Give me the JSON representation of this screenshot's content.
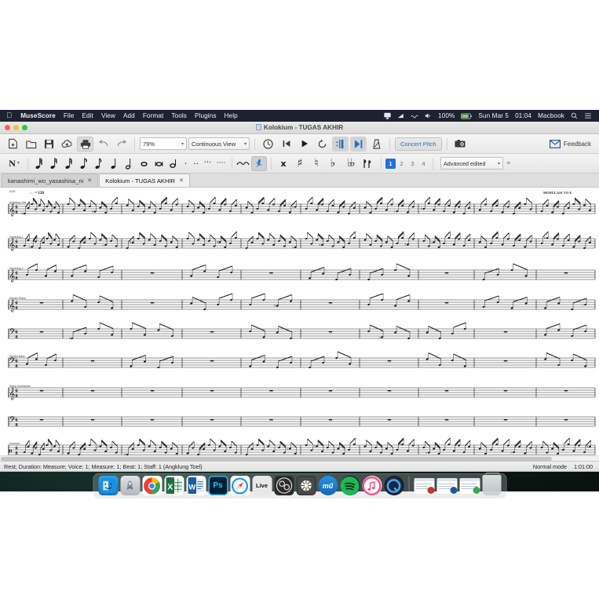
{
  "menubar": {
    "apple": "apple-logo",
    "app_name": "MuseScore",
    "items": [
      "File",
      "Edit",
      "View",
      "Add",
      "Format",
      "Tools",
      "Plugins",
      "Help"
    ],
    "status_items": [
      {
        "name": "airplay-icon",
        "label": "⌹"
      },
      {
        "name": "wifi-icon",
        "label": "◢"
      },
      {
        "name": "bluetooth-icon",
        "label": "∿"
      },
      {
        "name": "volume-icon",
        "label": "🔊"
      }
    ],
    "battery_percent": "100%",
    "date": "Sun Mar 5",
    "time": "01:04",
    "user": "Macbook",
    "search_icon": "search-icon",
    "control_center_icon": "control-center-icon"
  },
  "window": {
    "title": "Kolokium - TUGAS AKHIR"
  },
  "toolbar": {
    "buttons": [
      {
        "name": "new-score-button",
        "glyph": "➕",
        "pressed": false
      },
      {
        "name": "open-score-button",
        "glyph": "🗁",
        "pressed": false
      },
      {
        "name": "save-score-button",
        "glyph": "💾",
        "pressed": false
      },
      {
        "name": "save-online-button",
        "glyph": "☁",
        "pressed": false
      },
      {
        "name": "print-button",
        "glyph": "🖨",
        "pressed": true
      },
      {
        "name": "undo-button",
        "glyph": "↶",
        "pressed": false
      },
      {
        "name": "redo-button",
        "glyph": "↷",
        "pressed": false
      }
    ],
    "zoom_value": "79%",
    "view_value": "Continuous View",
    "playback": [
      {
        "name": "metronome-button",
        "glyph": "⏱"
      },
      {
        "name": "rewind-button",
        "glyph": "◀▌"
      },
      {
        "name": "play-button",
        "glyph": "▶"
      },
      {
        "name": "loop-button",
        "glyph": "↻"
      },
      {
        "name": "play-repeats-button",
        "glyph": "∥"
      },
      {
        "name": "play-panel-button",
        "glyph": "▶▌"
      },
      {
        "name": "metronome-toggle-button",
        "glyph": "↗"
      }
    ],
    "concert_pitch_label": "Concert Pitch",
    "image_capture_name": "image-capture-button",
    "feedback_label": "Feedback"
  },
  "note_toolbar": {
    "note_input_label": "N",
    "durations": [
      {
        "name": "duration-64th",
        "glyph": "♫"
      },
      {
        "name": "duration-32nd",
        "glyph": "♫"
      },
      {
        "name": "duration-16th",
        "glyph": "♫"
      },
      {
        "name": "duration-eighth",
        "glyph": "♪"
      },
      {
        "name": "duration-eighth-2",
        "glyph": "♪"
      },
      {
        "name": "duration-quarter",
        "glyph": "♩"
      },
      {
        "name": "duration-half",
        "glyph": "ᴕe"
      },
      {
        "name": "duration-whole",
        "glyph": "ᴕd"
      },
      {
        "name": "duration-breve",
        "glyph": "ᴕc"
      },
      {
        "name": "duration-longa",
        "glyph": "ᴛ6"
      }
    ],
    "dots": [
      {
        "name": "dot-single",
        "glyph": "·"
      },
      {
        "name": "dot-double",
        "glyph": "··"
      },
      {
        "name": "dot-triple",
        "glyph": "···"
      },
      {
        "name": "dot-quadruple",
        "glyph": "····"
      }
    ],
    "tie_name": "tie-button",
    "rest_name": "rest-button",
    "accidentals": [
      {
        "name": "accidental-double-sharp",
        "glyph": "𝄪"
      },
      {
        "name": "accidental-sharp",
        "glyph": "♯"
      },
      {
        "name": "accidental-natural",
        "glyph": "♮"
      },
      {
        "name": "accidental-flat",
        "glyph": "♭"
      },
      {
        "name": "accidental-double-flat",
        "glyph": "𝄫"
      },
      {
        "name": "accidental-flip",
        "glyph": "℘"
      }
    ],
    "voices": [
      "1",
      "2",
      "3",
      "4"
    ],
    "active_voice": "1",
    "workspace_value": "Advanced edited"
  },
  "tabs": [
    {
      "name": "tab-kanashimi",
      "label": "kanashimi_wo_yasashisa_ni",
      "active": false,
      "close": "✕"
    },
    {
      "name": "tab-kolokium",
      "label": "Kolokium - TUGAS AKHIR",
      "active": true,
      "close": "✕"
    }
  ],
  "score": {
    "measure_number": "#152",
    "tempo": "♩ = 120",
    "rehearsal_text": "MODULASI TO E",
    "time_signature_top": "6",
    "time_signature_bottom": "8",
    "instruments": [
      {
        "name": "staff-angklung-toel",
        "label": "Angklung Toel",
        "clef": "treble"
      },
      {
        "name": "staff-gambang-1",
        "label": "Gambang 1",
        "clef": "treble"
      },
      {
        "name": "staff-gambang-2",
        "label": "Gambang 2",
        "clef": "treble"
      },
      {
        "name": "staff-electric-piano-rh",
        "label": "Electric Piano",
        "clef": "treble"
      },
      {
        "name": "staff-electric-piano-lh",
        "label": "",
        "clef": "bass"
      },
      {
        "name": "staff-electric-bass",
        "label": "Electric Bass",
        "clef": "bass"
      },
      {
        "name": "staff-string-synth-rh",
        "label": "String Synthesizer",
        "clef": "treble"
      },
      {
        "name": "staff-string-synth-lh",
        "label": "",
        "clef": "bass"
      },
      {
        "name": "staff-drumset",
        "label": "Drumset",
        "clef": "percussion"
      }
    ]
  },
  "statusbar": {
    "selection_info": "Rest; Duration: Measure; Voice: 1;  Measure: 1; Beat: 1; Staff: 1 (Angklung Toel)",
    "mode": "Normal mode",
    "timecode": "1:01:00"
  },
  "dock": {
    "items": [
      {
        "name": "dock-finder",
        "label": "☺",
        "color": "#1e8fe0",
        "running": true
      },
      {
        "name": "dock-launchpad",
        "label": "🚀",
        "color": "#b9bfc4",
        "running": false
      },
      {
        "name": "dock-chrome",
        "label": "",
        "color": "#ffffff",
        "running": true
      },
      {
        "name": "dock-excel",
        "label": "X",
        "color": "#1d7044",
        "running": false
      },
      {
        "name": "dock-word",
        "label": "W",
        "color": "#1b5ba0",
        "running": false
      },
      {
        "name": "dock-photoshop",
        "label": "Ps",
        "color": "#001e36",
        "running": false
      },
      {
        "name": "dock-safari",
        "label": "◉",
        "color": "#1b8ef2",
        "running": false
      },
      {
        "name": "dock-ableton-live",
        "label": "Live",
        "color": "#e8e8e8",
        "running": false
      },
      {
        "name": "dock-obs",
        "label": "◎",
        "color": "#2b2b2b",
        "running": false
      },
      {
        "name": "dock-photos",
        "label": "✺",
        "color": "#3a3a3a",
        "running": false
      },
      {
        "name": "dock-musescore",
        "label": "mű",
        "color": "#1878c8",
        "running": true
      },
      {
        "name": "dock-spotify",
        "label": "♬",
        "color": "#1db954",
        "running": false
      },
      {
        "name": "dock-itunes",
        "label": "♪",
        "color": "#fb4b84",
        "running": false
      },
      {
        "name": "dock-quicktime",
        "label": "◉",
        "color": "#1a4fa0",
        "running": false
      }
    ],
    "minimized": [
      {
        "name": "dock-window-musescore",
        "badge": "#c0392b"
      },
      {
        "name": "dock-window-word",
        "badge": "#1b5ba0"
      },
      {
        "name": "dock-window-chrome",
        "badge": "#34a853"
      }
    ],
    "trash_name": "dock-trash"
  }
}
